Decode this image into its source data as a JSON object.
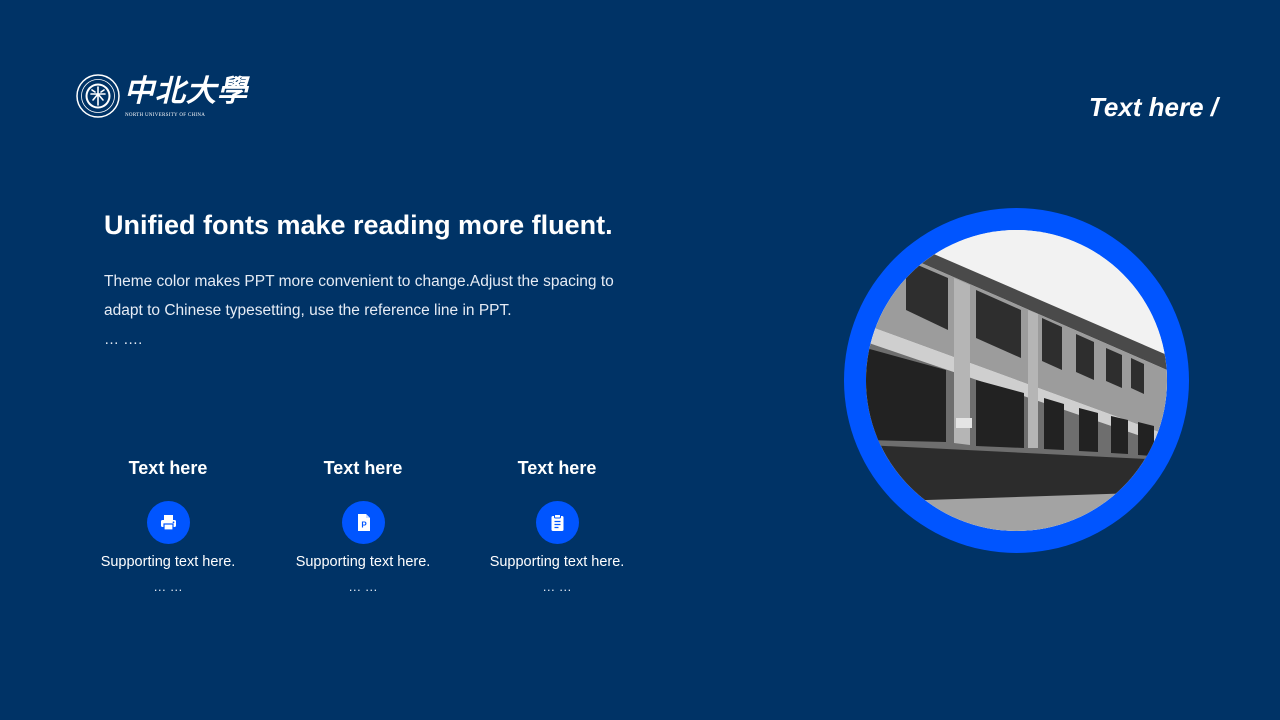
{
  "header": {
    "logo_cn": "中北大學",
    "logo_en": "NORTH UNIVERSITY OF CHINA",
    "right_label": "Text here /"
  },
  "main": {
    "headline": "Unified fonts make reading more fluent.",
    "body": "Theme color makes PPT more convenient to change.Adjust the spacing to adapt to Chinese typesetting, use the reference line in PPT.",
    "dots": "… ….",
    "features": [
      {
        "title": "Text here",
        "icon": "printer-icon",
        "text": "Supporting text here.",
        "dots": "… …"
      },
      {
        "title": "Text here",
        "icon": "ppt-file-icon",
        "text": "Supporting text here.",
        "dots": "… …"
      },
      {
        "title": "Text here",
        "icon": "clipboard-icon",
        "text": "Supporting text here.",
        "dots": "… …"
      }
    ]
  },
  "photo": {
    "subject": "building-photo"
  },
  "colors": {
    "background": "#003366",
    "accent": "#0055ff",
    "text": "#ffffff"
  }
}
